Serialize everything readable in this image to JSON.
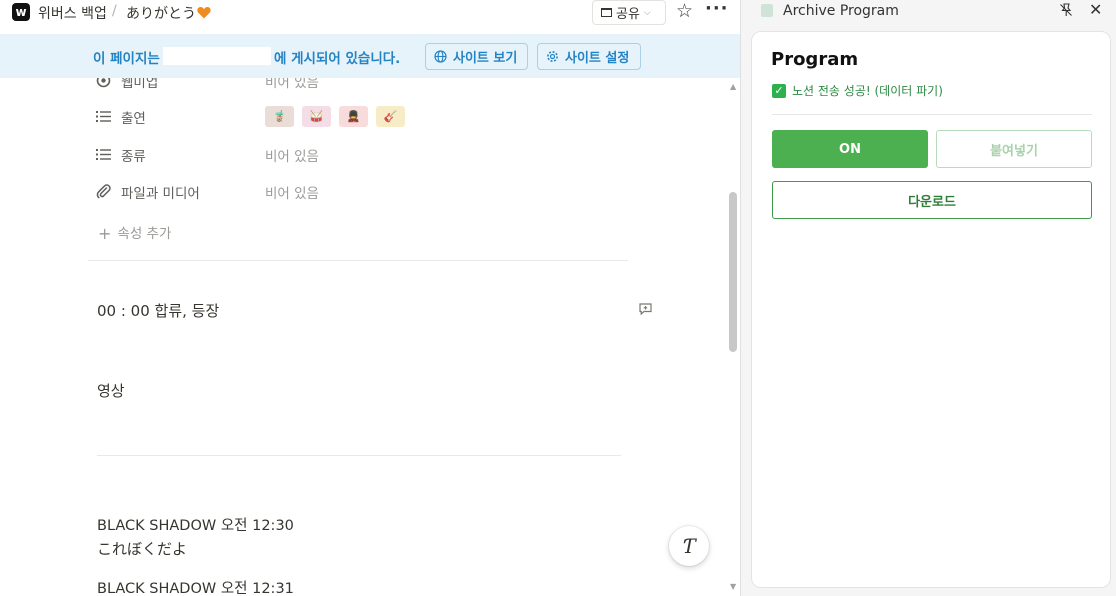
{
  "breadcrumb": {
    "workspace": "위버스 백업",
    "separator": "/",
    "page": "ありがとう"
  },
  "header": {
    "share_label": "공유",
    "star_icon": "star-icon",
    "more_icon": "more-icon"
  },
  "banner": {
    "text_prefix": "이 페이지는",
    "text_suffix": "에 게시되어 있습니다.",
    "view_site_label": "사이트 보기",
    "site_settings_label": "사이트 설정"
  },
  "properties": [
    {
      "name": "웹미업",
      "value": "비어 있음",
      "icon": "circle-icon"
    },
    {
      "name": "출연",
      "icon": "list-icon",
      "tags": [
        "🧋",
        "🥁",
        "💂",
        "🎸"
      ]
    },
    {
      "name": "종류",
      "value": "비어 있음",
      "icon": "list-icon"
    },
    {
      "name": "파일과 미디어",
      "value": "비어 있음",
      "icon": "paperclip-icon"
    }
  ],
  "add_property_label": "속성 추가",
  "blocks": {
    "time": "00 : 00 합류, 등장",
    "video": "영상",
    "msg1_author": "BLACK SHADOW 오전 12:30",
    "msg1_text": "これぼくだよ",
    "msg2_author": "BLACK SHADOW 오전 12:31"
  },
  "extension": {
    "title": "Archive Program",
    "card_title": "Program",
    "status": "노션 전송 성공! (데이터 파기)",
    "on_label": "ON",
    "paste_label": "붙여넣기",
    "download_label": "다운로드"
  },
  "colors": {
    "accent_blue": "#2383c4",
    "banner_bg": "#e7f3fb",
    "green": "#4caf50",
    "heart": "#f08c1e"
  }
}
